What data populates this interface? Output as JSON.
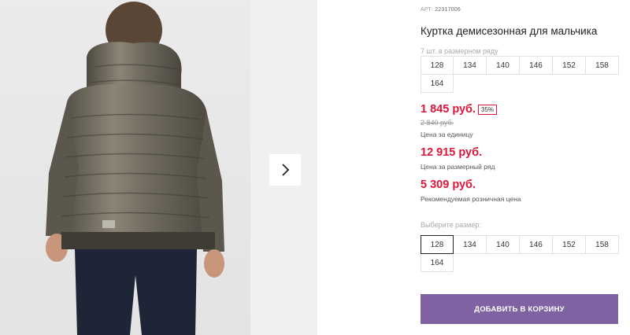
{
  "product": {
    "article_label": "АРТ:",
    "article_number": "22317006",
    "title": "Куртка демисезонная для мальчика",
    "row_label": "7 шт. в размерном ряду",
    "row_sizes": [
      "128",
      "134",
      "140",
      "146",
      "152",
      "158",
      "164"
    ]
  },
  "pricing": {
    "price": "1 845 руб.",
    "discount": "35%",
    "old_price": "2 840 руб.",
    "unit_label": "Цена за единицу",
    "row_price": "12 915 руб.",
    "row_price_label": "Цена за размерный ряд",
    "retail_price": "5 309 руб.",
    "retail_label": "Рекомендуемая розничная цена"
  },
  "size_picker": {
    "label": "Выберите размер:",
    "sizes": [
      "128",
      "134",
      "140",
      "146",
      "152",
      "158",
      "164"
    ],
    "selected": "128"
  },
  "actions": {
    "add_to_cart": "ДОБАВИТЬ В КОРЗИНУ"
  },
  "icons": {
    "next": "chevron-right-icon"
  },
  "colors": {
    "price": "#e0153a",
    "button": "#7e62a2"
  }
}
